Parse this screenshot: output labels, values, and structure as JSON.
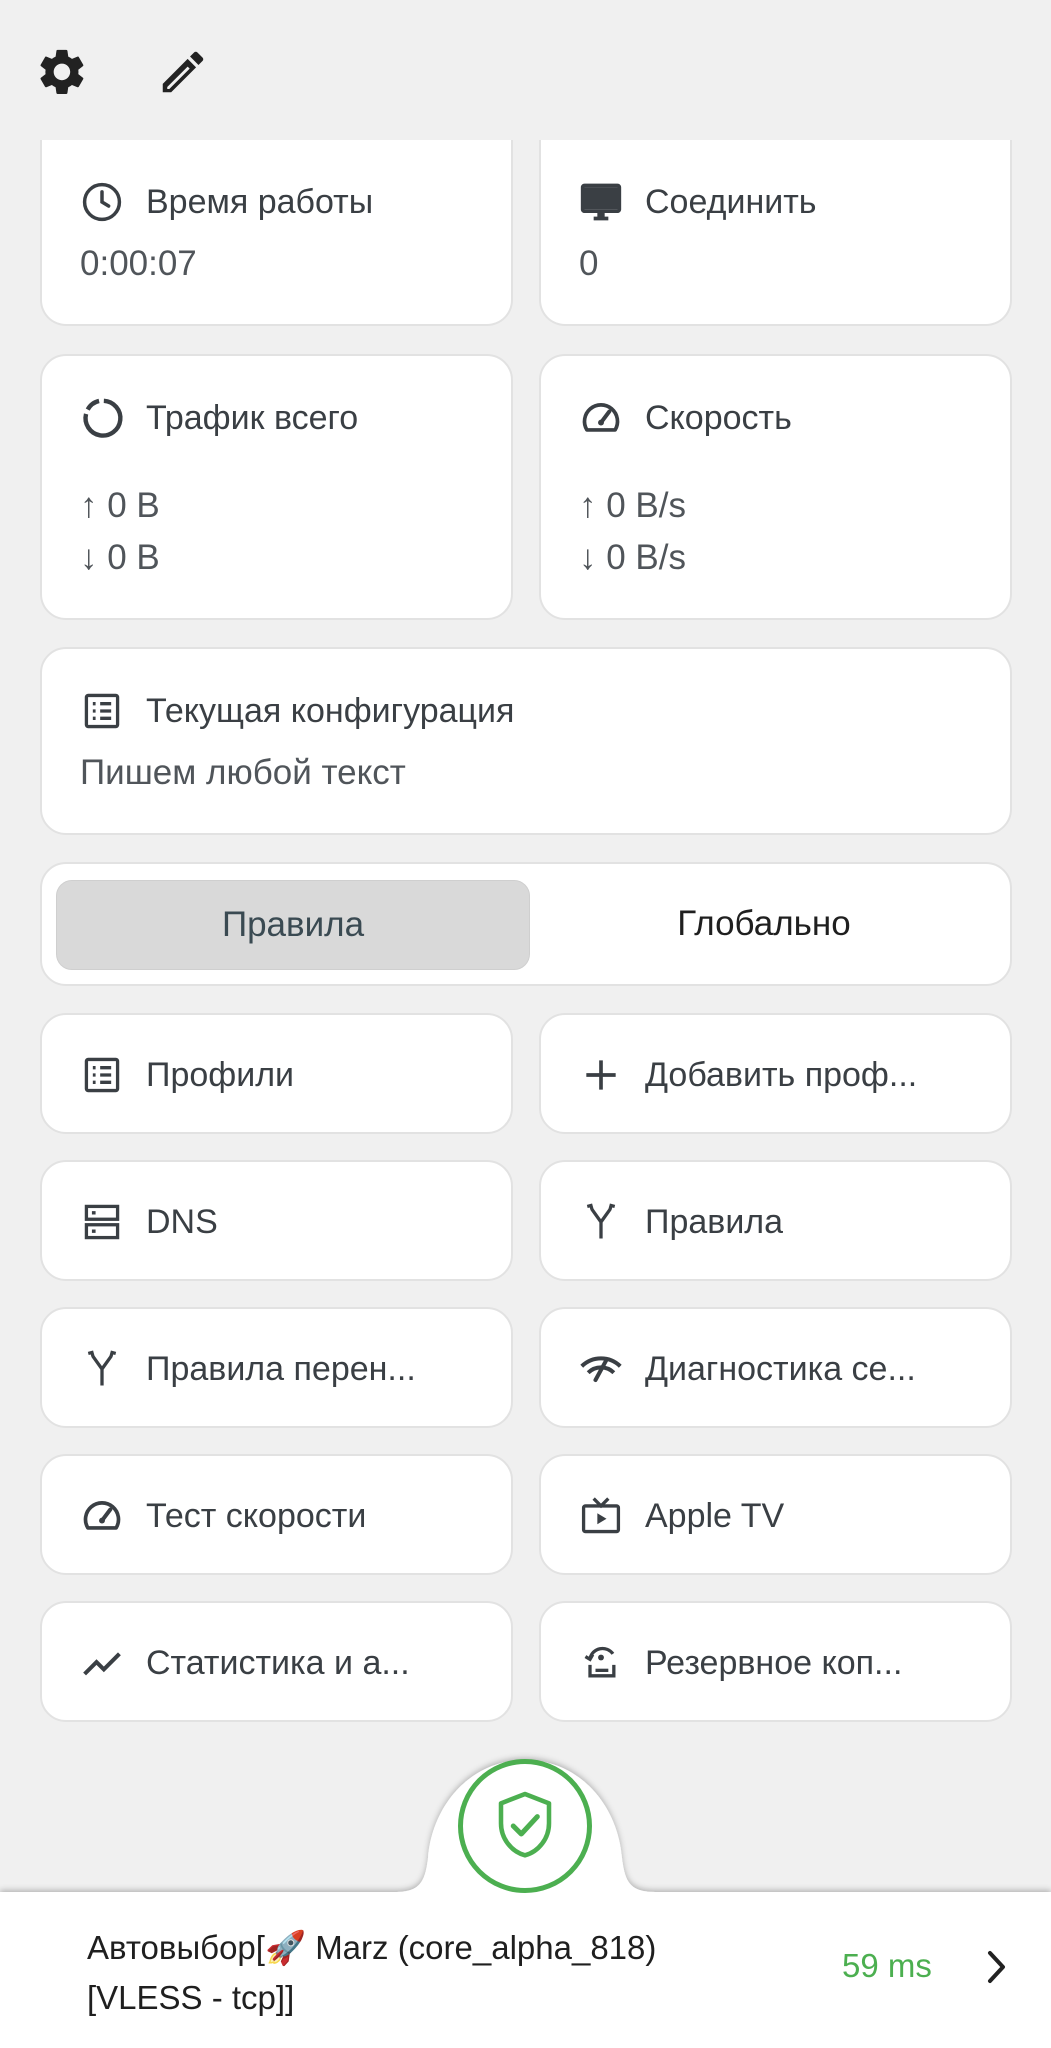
{
  "header": {
    "settings_icon": "gear-icon",
    "edit_icon": "pencil-icon"
  },
  "stats": {
    "uptime": {
      "icon": "clock-icon",
      "label": "Время работы",
      "value": "0:00:07"
    },
    "connections": {
      "icon": "monitor-icon",
      "label": "Соединить",
      "value": "0"
    },
    "traffic": {
      "icon": "ring-icon",
      "label": "Трафик всего",
      "up": "↑ 0 B",
      "down": "↓ 0 B"
    },
    "speed": {
      "icon": "speedometer-icon",
      "label": "Скорость",
      "up": "↑ 0 B/s",
      "down": "↓ 0 B/s"
    }
  },
  "config": {
    "icon": "list-icon",
    "label": "Текущая конфигурация",
    "value": "Пишем любой текст"
  },
  "mode": {
    "options": [
      "Правила",
      "Глобально"
    ],
    "selected": "Правила"
  },
  "tiles": [
    {
      "icon": "list-icon",
      "label": "Профили"
    },
    {
      "icon": "plus-icon",
      "label": "Добавить проф..."
    },
    {
      "icon": "server-icon",
      "label": "DNS"
    },
    {
      "icon": "route-icon",
      "label": "Правила"
    },
    {
      "icon": "route-icon",
      "label": "Правила перен..."
    },
    {
      "icon": "network-check-icon",
      "label": "Диагностика се..."
    },
    {
      "icon": "speedometer-icon",
      "label": "Тест скорости"
    },
    {
      "icon": "tv-icon",
      "label": "Apple TV"
    },
    {
      "icon": "trend-icon",
      "label": "Статистика и а..."
    },
    {
      "icon": "backup-icon",
      "label": "Резервное коп..."
    }
  ],
  "connect_button": {
    "icon": "shield-check-icon",
    "status_color": "#4caf50"
  },
  "server": {
    "line1": "Автовыбор[🚀 Marz (core_alpha_818)",
    "line2": "[VLESS - tcp]]",
    "latency": "59 ms",
    "latency_color": "#4caf50",
    "chevron": "chevron-right-icon"
  }
}
